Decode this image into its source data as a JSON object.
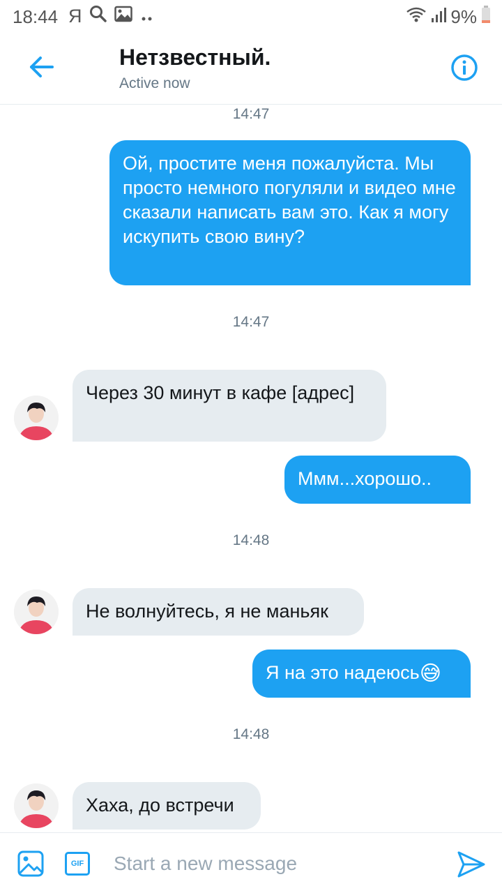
{
  "status_bar": {
    "time": "18:44",
    "carrier_icon_label": "Я",
    "battery_percent": "9%",
    "icons": [
      "search-icon",
      "image-icon",
      "more-dots-icon",
      "wifi-icon",
      "signal-icon",
      "battery-icon"
    ]
  },
  "header": {
    "title": "Нетзвестный.",
    "subtitle": "Active now",
    "back_icon": "arrow-left-icon",
    "info_icon": "info-icon"
  },
  "conversation": {
    "timestamps": [
      "14:47",
      "14:47",
      "14:48",
      "14:48"
    ],
    "messages": [
      {
        "direction": "out",
        "text": "Ой, простите меня пожалуйста. Мы просто немного погуляли и видео мне сказали написать вам это. Как я могу искупить свою вину?"
      },
      {
        "direction": "in",
        "text": "Через 30 минут в кафе [адрес]"
      },
      {
        "direction": "out",
        "text": "Ммм...хорошо.."
      },
      {
        "direction": "in",
        "text": "Не волнуйтесь, я не маньяк"
      },
      {
        "direction": "out",
        "text": "Я на это надеюсь",
        "emoji": "😅"
      },
      {
        "direction": "in",
        "text": "Хаха, до встречи"
      }
    ]
  },
  "composer": {
    "placeholder": "Start a new message",
    "gif_label": "GIF",
    "media_icon": "image-icon",
    "send_icon": "send-icon"
  },
  "colors": {
    "accent": "#1da1f2",
    "incoming_bubble": "#e6ecf0",
    "secondary_text": "#657786"
  }
}
